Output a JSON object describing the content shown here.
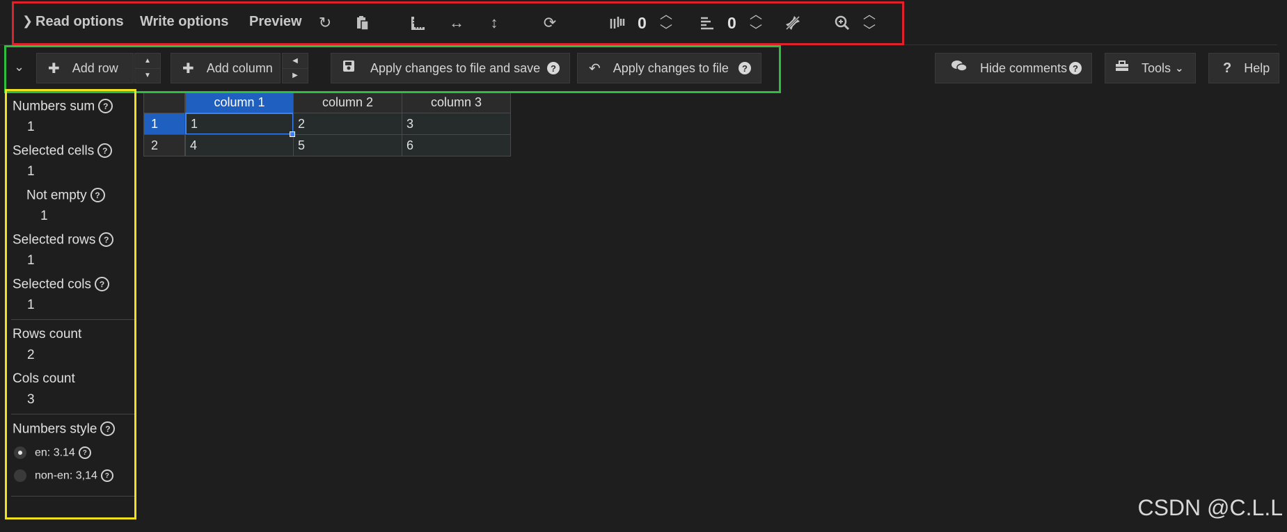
{
  "top_toolbar": {
    "read_options": "Read options",
    "write_options": "Write options",
    "preview": "Preview",
    "freeze_columns_value": "0",
    "freeze_rows_value": "0"
  },
  "edit_toolbar": {
    "add_row": "Add row",
    "add_column": "Add column",
    "apply_save": "Apply changes to file and save",
    "apply": "Apply changes to file",
    "hide_comments": "Hide comments",
    "tools": "Tools",
    "help": "Help"
  },
  "stats": {
    "numbers_sum_label": "Numbers sum",
    "numbers_sum_value": "1",
    "selected_cells_label": "Selected cells",
    "selected_cells_value": "1",
    "not_empty_label": "Not empty",
    "not_empty_value": "1",
    "selected_rows_label": "Selected rows",
    "selected_rows_value": "1",
    "selected_cols_label": "Selected cols",
    "selected_cols_value": "1",
    "rows_count_label": "Rows count",
    "rows_count_value": "2",
    "cols_count_label": "Cols count",
    "cols_count_value": "3",
    "numbers_style_label": "Numbers style",
    "style_en": "en: 3.14",
    "style_non_en": "non-en: 3,14"
  },
  "table": {
    "headers": [
      "column 1",
      "column 2",
      "column 3"
    ],
    "row_labels": [
      "1",
      "2"
    ],
    "rows": [
      [
        "1",
        "2",
        "3"
      ],
      [
        "4",
        "5",
        "6"
      ]
    ]
  },
  "watermark": "CSDN @C.L.L",
  "colors": {
    "background": "#1e1e1e",
    "selection": "#1f5fbf",
    "frame_red": "#e0202a",
    "frame_green": "#2fbf3f",
    "frame_yellow": "#f0e020"
  }
}
